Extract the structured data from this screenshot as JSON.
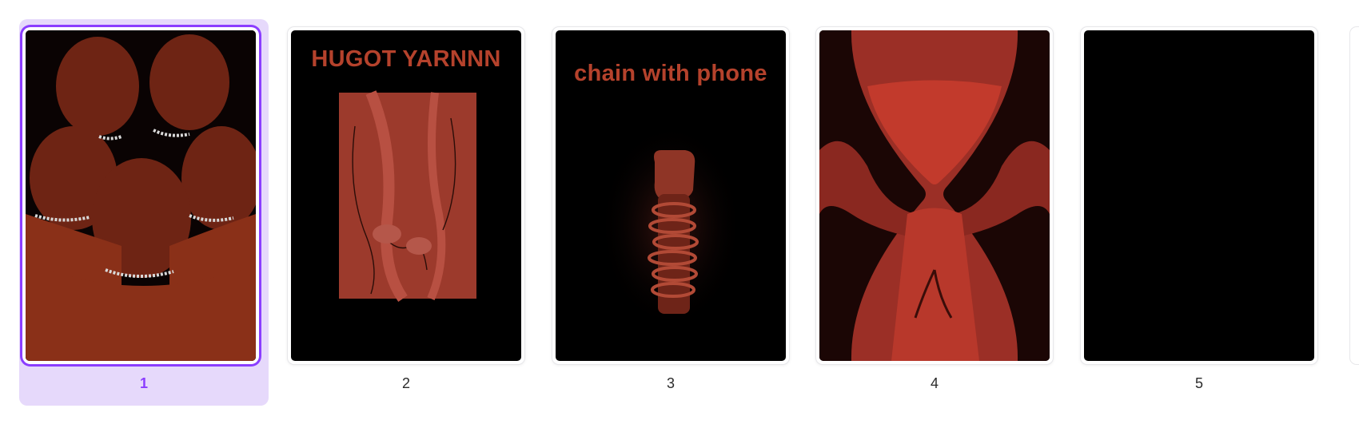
{
  "pages": [
    {
      "number": "1",
      "title": "",
      "selected": true
    },
    {
      "number": "2",
      "title": "HUGOT YARNNN",
      "selected": false
    },
    {
      "number": "3",
      "title": "chain with phone",
      "selected": false
    },
    {
      "number": "4",
      "title": "",
      "selected": false
    },
    {
      "number": "5",
      "title": "",
      "selected": false
    }
  ],
  "colors": {
    "accent": "#8b3dff",
    "selected_bg": "#e6d9fb",
    "title_red": "#b5422c"
  }
}
